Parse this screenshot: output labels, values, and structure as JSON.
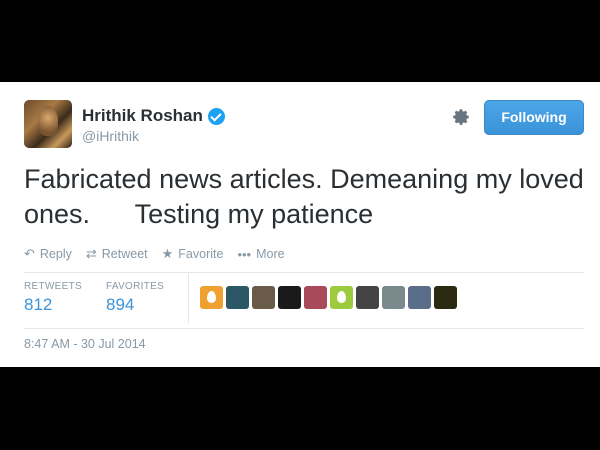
{
  "tweet": {
    "author": {
      "name": "Hrithik Roshan",
      "handle": "@iHrithik",
      "verified": true
    },
    "follow_label": "Following",
    "text": "Fabricated news articles. Demeaning my loved ones.      Testing my patience",
    "actions": {
      "reply": "Reply",
      "retweet": "Retweet",
      "favorite": "Favorite",
      "more": "More"
    },
    "stats": {
      "retweets_label": "RETWEETS",
      "retweets_value": "812",
      "favorites_label": "FAVORITES",
      "favorites_value": "894"
    },
    "timestamp": "8:47 AM - 30 Jul 2014"
  },
  "favoriter_avatars": [
    {
      "name": "egg-orange",
      "color": "#f0a030"
    },
    {
      "name": "photo",
      "color": "#2c5866"
    },
    {
      "name": "photo",
      "color": "#6a5a48"
    },
    {
      "name": "photo",
      "color": "#1a1a1a"
    },
    {
      "name": "photo",
      "color": "#a84a5a"
    },
    {
      "name": "egg-green",
      "color": "#9ccc3d"
    },
    {
      "name": "photo",
      "color": "#444444"
    },
    {
      "name": "photo",
      "color": "#7a8a8c"
    },
    {
      "name": "photo",
      "color": "#5a6e8a"
    },
    {
      "name": "photo",
      "color": "#2a2a10"
    }
  ],
  "colors": {
    "link": "#3b94d9",
    "button": "#3a93d8",
    "verified": "#1da1f2",
    "muted": "#8899a6"
  }
}
